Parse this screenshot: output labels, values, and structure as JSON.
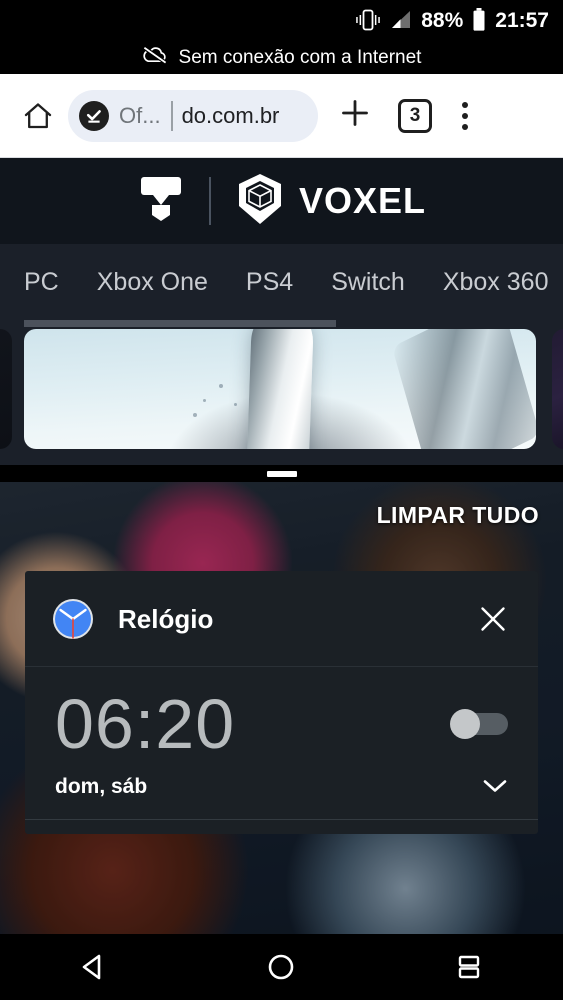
{
  "status_bar": {
    "vibrate_icon": "vibrate-icon",
    "signal_icon": "signal-icon",
    "battery_percent": "88%",
    "battery_icon": "battery-icon",
    "time": "21:57"
  },
  "offline_notice": {
    "icon": "cloud-off-icon",
    "text": "Sem conexão com a Internet"
  },
  "browser": {
    "home_icon": "home-icon",
    "download_badge_icon": "download-complete-icon",
    "omnibox_prefix": "Of...",
    "omnibox_url": "do.com.br",
    "new_tab_icon": "plus-icon",
    "tab_count": "3",
    "menu_icon": "overflow-menu-icon"
  },
  "site": {
    "brand": "VOXEL",
    "logo_icon": "voxel-cube-icon",
    "mark_icon": "tm-mark-icon",
    "nav": [
      {
        "label": "PC"
      },
      {
        "label": "Xbox One"
      },
      {
        "label": "PS4"
      },
      {
        "label": "Switch"
      },
      {
        "label": "Xbox 360"
      }
    ]
  },
  "shade": {
    "handle": "drag-handle",
    "clear_all_label": "LIMPAR TUDO"
  },
  "notification": {
    "app_icon": "clock-icon",
    "app_name": "Relógio",
    "close_icon": "close-icon",
    "alarm_time": "06:20",
    "toggle_state": "off",
    "alarm_days": "dom, sáb",
    "expand_icon": "chevron-down-icon"
  },
  "navbar": {
    "back_icon": "back-triangle-icon",
    "home_icon": "home-circle-icon",
    "recents_icon": "recents-split-icon"
  },
  "colors": {
    "site_header_bg": "#10151c",
    "site_nav_bg": "#1b2029",
    "notif_bg": "#1b2025",
    "clock_blue": "#4285f4",
    "omnibox_bg": "#eaeef6",
    "accent_red": "#ea4335"
  }
}
